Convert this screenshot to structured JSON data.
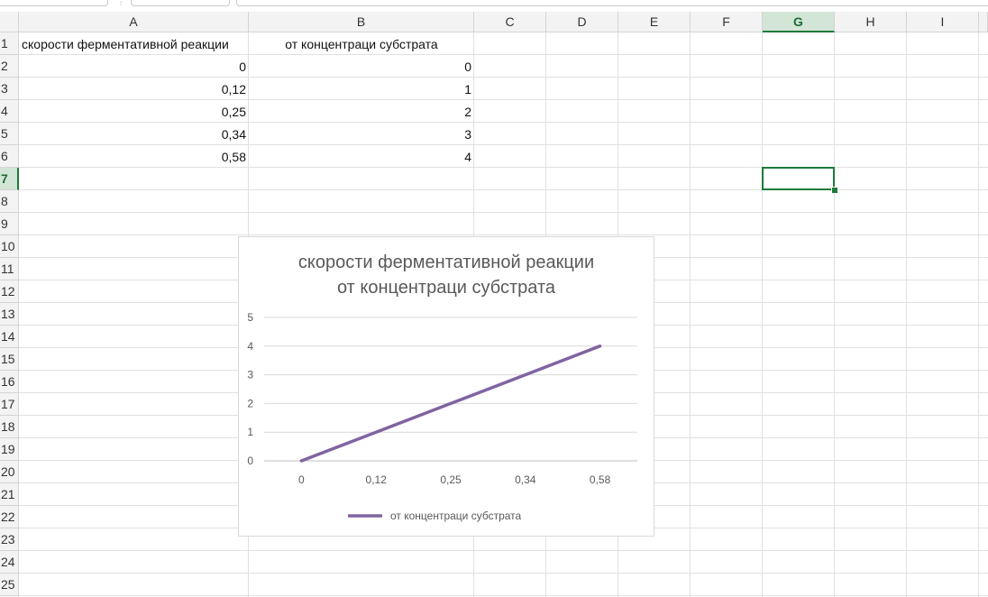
{
  "sheet": {
    "columns": [
      "A",
      "B",
      "C",
      "D",
      "E",
      "F",
      "G",
      "H",
      "I"
    ],
    "selected_column": "G",
    "rows": [
      "1",
      "2",
      "3",
      "4",
      "5",
      "6",
      "7",
      "8",
      "9",
      "10",
      "11",
      "12",
      "13",
      "14",
      "15",
      "16",
      "17",
      "18",
      "19",
      "20",
      "21",
      "22",
      "23",
      "24",
      "25"
    ],
    "selected_row": "7",
    "table": {
      "header": [
        "скорости ферментативной реакции",
        "от концентраци субстрата"
      ],
      "rows": [
        [
          "0",
          "0"
        ],
        [
          "0,12",
          "1"
        ],
        [
          "0,25",
          "2"
        ],
        [
          "0,34",
          "3"
        ],
        [
          "0,58",
          "4"
        ]
      ]
    },
    "active_cell": "G7",
    "colors": {
      "accent": "#1d7a3a",
      "header_bg": "#f3f3f3",
      "selected_header_bg": "#d3e5d6",
      "grid": "#e1e1e1"
    }
  },
  "chart_data": {
    "type": "line",
    "title": "скорости ферментативной реакции от концентраци субстрата",
    "title_lines": [
      "скорости ферментативной реакции",
      "от концентраци субстрата"
    ],
    "categories": [
      "0",
      "0,12",
      "0,25",
      "0,34",
      "0,58"
    ],
    "series": [
      {
        "name": "от концентраци субстрата",
        "values": [
          0,
          1,
          2,
          3,
          4
        ],
        "color": "#8064a2"
      }
    ],
    "y_ticks": [
      "0",
      "1",
      "2",
      "3",
      "4",
      "5"
    ],
    "ylim": [
      0,
      5
    ],
    "grid": true,
    "legend": "bottom"
  }
}
